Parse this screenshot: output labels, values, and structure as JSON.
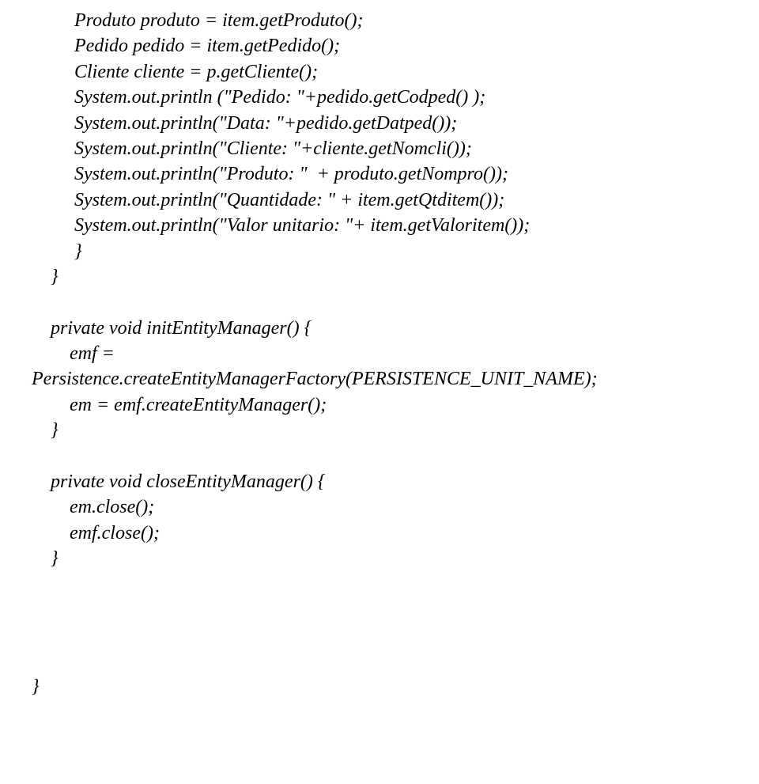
{
  "code": {
    "l1": "         Produto produto = item.getProduto();",
    "l2": "         Pedido pedido = item.getPedido();",
    "l3": "         Cliente cliente = p.getCliente();",
    "l4": "         System.out.println (\"Pedido: \"+pedido.getCodped() );",
    "l5": "         System.out.println(\"Data: \"+pedido.getDatped());",
    "l6": "         System.out.println(\"Cliente: \"+cliente.getNomcli());",
    "l7": "         System.out.println(\"Produto: \"  + produto.getNompro());",
    "l8": "         System.out.println(\"Quantidade: \" + item.getQtditem());",
    "l9": "         System.out.println(\"Valor unitario: \"+ item.getValoritem());",
    "l10": "         }",
    "l11": "    }",
    "l12": "",
    "l13": "    private void initEntityManager() {",
    "l14": "        emf =",
    "l15": "Persistence.createEntityManagerFactory(PERSISTENCE_UNIT_NAME);",
    "l16": "        em = emf.createEntityManager();",
    "l17": "    }",
    "l18": "",
    "l19": "    private void closeEntityManager() {",
    "l20": "        em.close();",
    "l21": "        emf.close();",
    "l22": "    }",
    "l23": "",
    "l24": "",
    "l25": "",
    "l26": "",
    "l27": "}"
  }
}
